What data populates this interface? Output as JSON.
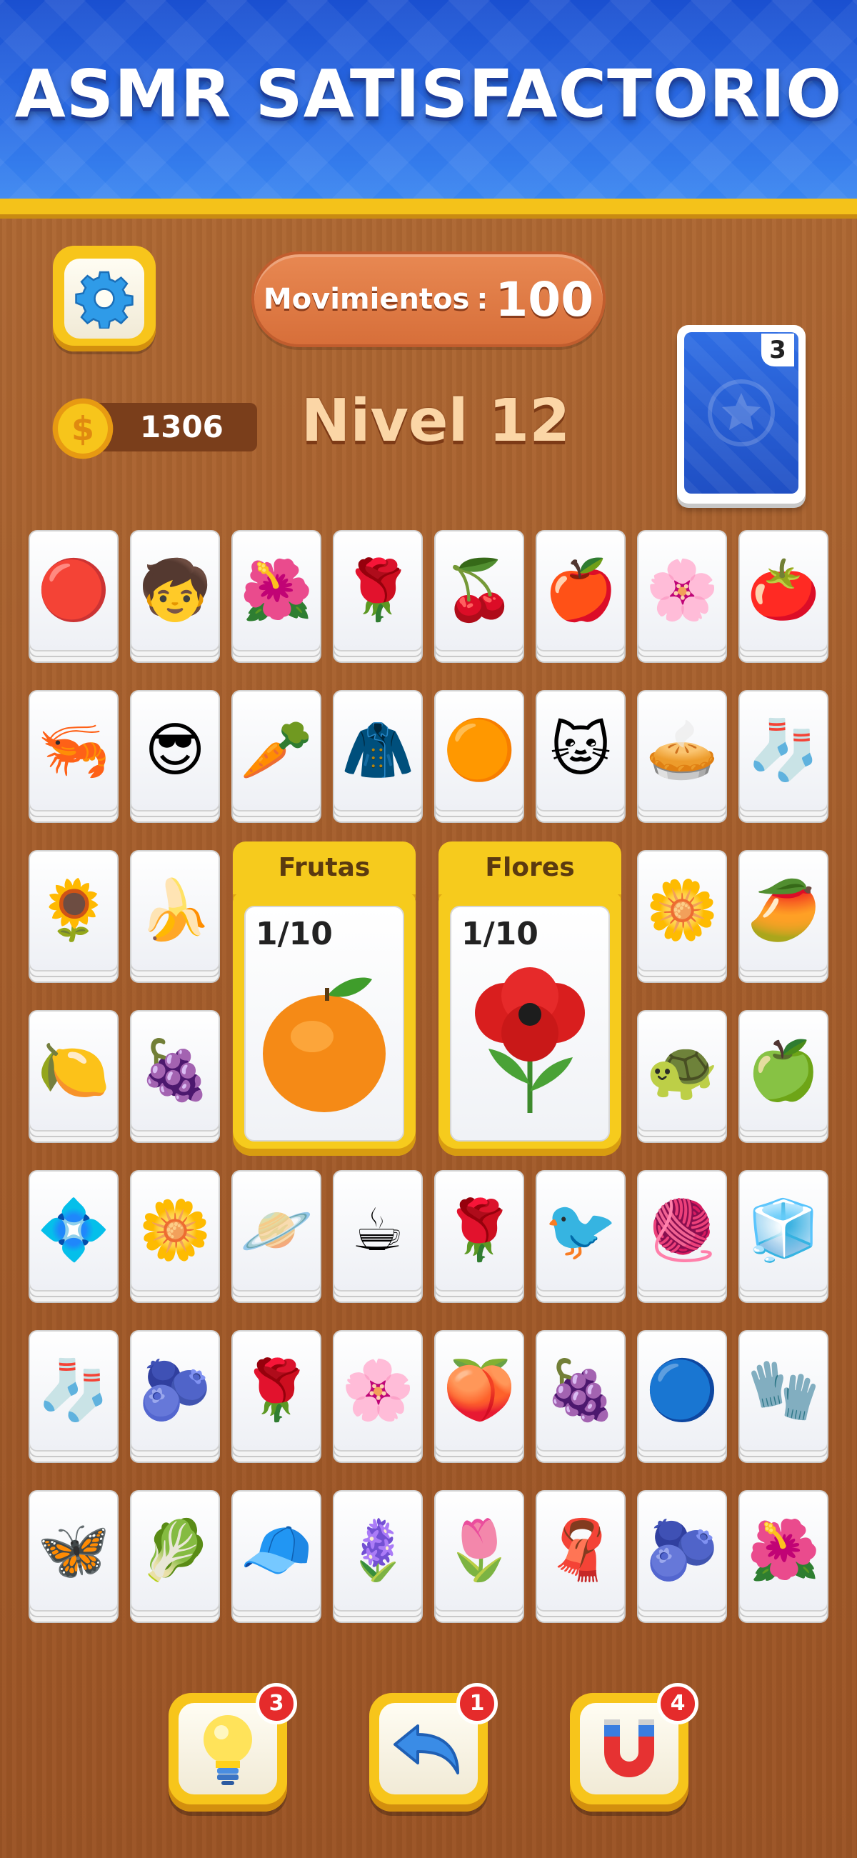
{
  "header": {
    "title": "ASMR SATISFACTORIO"
  },
  "hud": {
    "settings_icon": "gear-icon",
    "moves_label": "Movimientos",
    "moves_sep": ":",
    "moves_value": "100",
    "coins": "1306",
    "level": "Nivel 12",
    "deck_count": "3"
  },
  "grid": {
    "rows": [
      [
        "🔴",
        "🧒",
        "🌺",
        "🌹",
        "🍒",
        "🍎",
        "🌸",
        "🍅"
      ],
      [
        "🦐",
        "😎",
        "🥕",
        "🧥",
        "🟠",
        "🐱",
        "🥧",
        "🧦"
      ],
      [
        "🌻",
        "🍌",
        null,
        null,
        null,
        null,
        "🌼",
        "🥭"
      ],
      [
        "🍋",
        "🍇",
        null,
        null,
        null,
        null,
        "🐢",
        "🍏"
      ],
      [
        "💠",
        "🌼",
        "🪐",
        "☕",
        "🌹",
        "🐦",
        "🧶",
        "🧊"
      ],
      [
        "🧦",
        "🫐",
        "🌹",
        "🌸",
        "🍑",
        "🍇",
        "🔵",
        "🧤"
      ],
      [
        "🦋",
        "🥬",
        "🧢",
        "🪻",
        "🌷",
        "🧣",
        "🫐",
        "🌺"
      ]
    ]
  },
  "categories": [
    {
      "title": "Frutas",
      "count": "1/10",
      "art": "orange"
    },
    {
      "title": "Flores",
      "count": "1/10",
      "art": "poppy"
    }
  ],
  "boosters": [
    {
      "name": "hint",
      "icon": "lightbulb-icon",
      "count": "3"
    },
    {
      "name": "undo",
      "icon": "undo-arrow-icon",
      "count": "1"
    },
    {
      "name": "magnet",
      "icon": "magnet-icon",
      "count": "4"
    }
  ],
  "colors": {
    "banner": "#2c6ee6",
    "gold": "#f7c51b",
    "wood": "#a45d2b",
    "moves_pill": "#e07a45",
    "badge": "#e52b2b"
  }
}
